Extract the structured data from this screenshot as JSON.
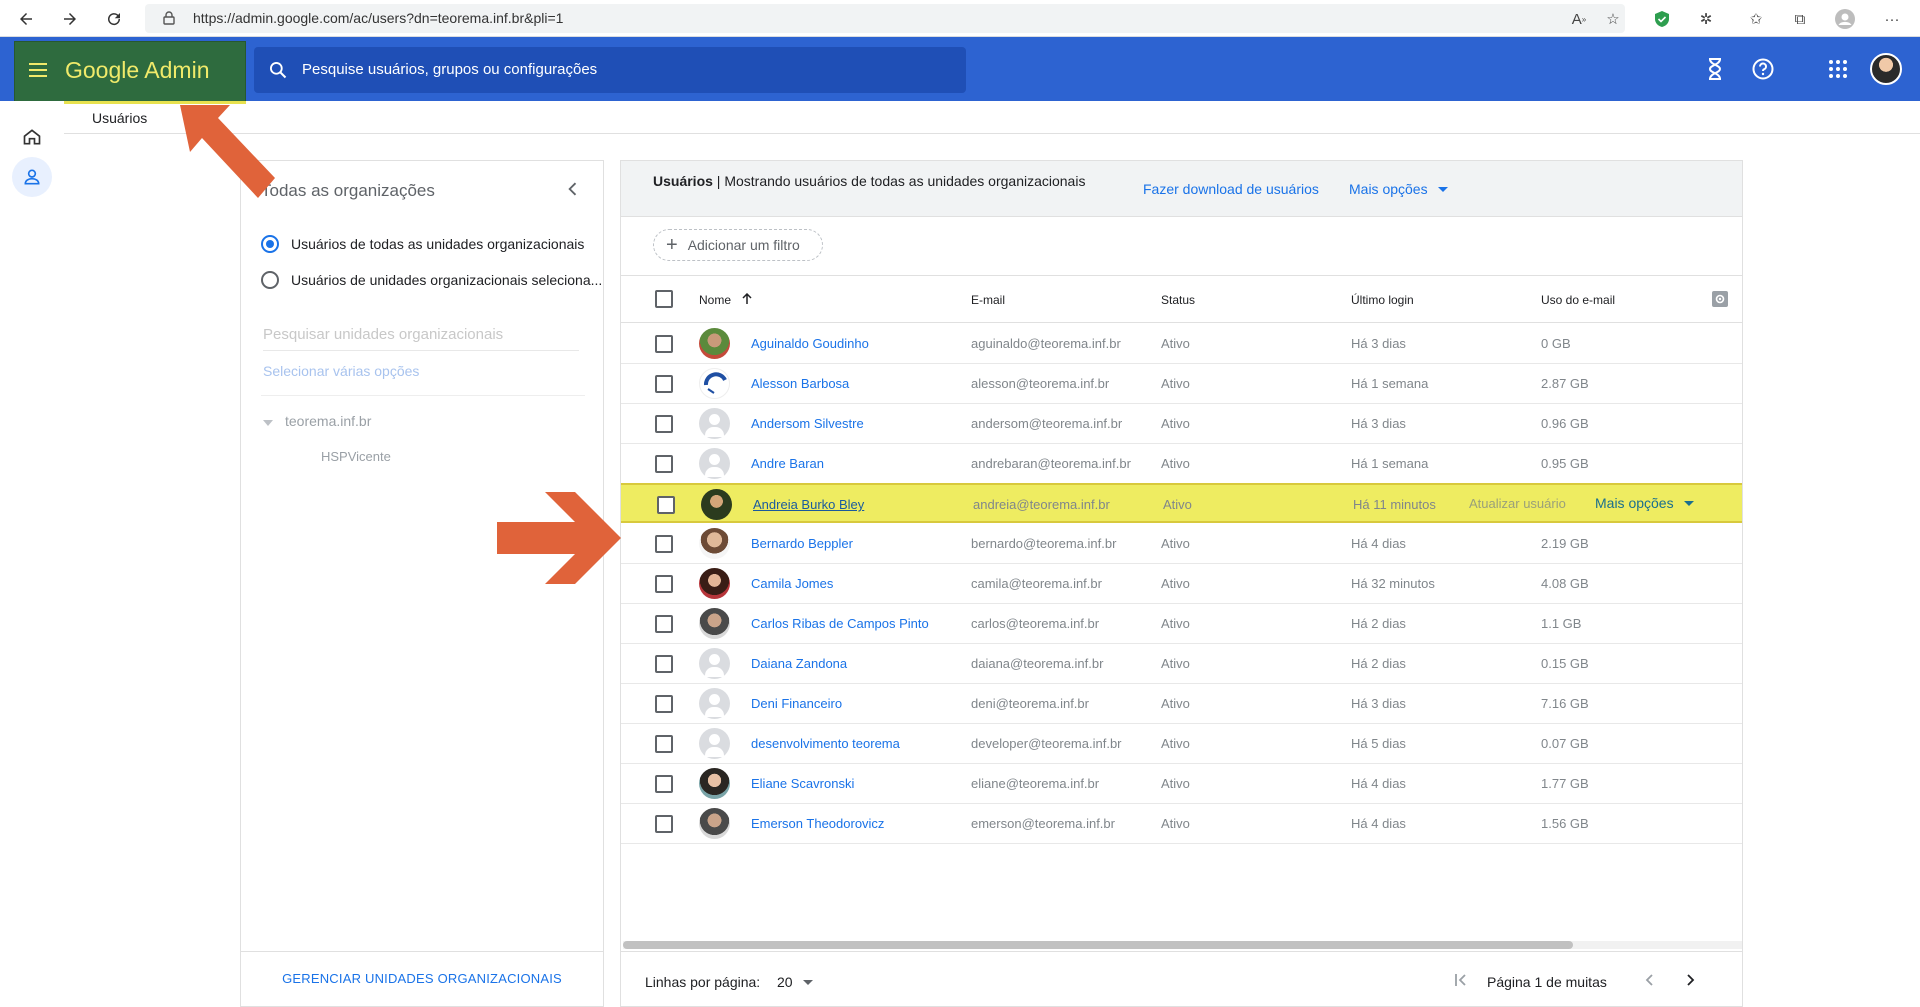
{
  "browser": {
    "url": "https://admin.google.com/ac/users?dn=teorema.inf.br&pli=1",
    "more_label": "···"
  },
  "header": {
    "brand": "Google Admin",
    "search_placeholder": "Pesquise usuários, grupos ou configurações"
  },
  "breadcrumb": "Usuários",
  "org_panel": {
    "title": "Todas as organizações",
    "radio_all": "Usuários de todas as unidades organizacionais",
    "radio_selected": "Usuários de unidades organizacionais seleciona...",
    "search_placeholder": "Pesquisar unidades organizacionais",
    "select_multi": "Selecionar várias opções",
    "tree_root": "teorema.inf.br",
    "tree_child": "HSPVicente",
    "manage": "GERENCIAR UNIDADES ORGANIZACIONAIS"
  },
  "users_panel": {
    "title_bold": "Usuários",
    "title_rest": " | Mostrando usuários de todas as unidades organizacionais",
    "download": "Fazer download de usuários",
    "more_options": "Mais opções",
    "add_filter": "Adicionar um filtro",
    "columns": {
      "name": "Nome",
      "email": "E-mail",
      "status": "Status",
      "last_login": "Último login",
      "email_usage": "Uso do e-mail"
    },
    "rows": [
      {
        "name": "Aguinaldo Goudinho",
        "email": "aguinaldo@teorema.inf.br",
        "status": "Ativo",
        "last_login": "Há 3 dias",
        "usage": "0 GB",
        "avatar": "photo-green"
      },
      {
        "name": "Alesson Barbosa",
        "email": "alesson@teorema.inf.br",
        "status": "Ativo",
        "last_login": "Há 1 semana",
        "usage": "2.87 GB",
        "avatar": "logo-blue"
      },
      {
        "name": "Andersom Silvestre",
        "email": "andersom@teorema.inf.br",
        "status": "Ativo",
        "last_login": "Há 3 dias",
        "usage": "0.96 GB",
        "avatar": "default"
      },
      {
        "name": "Andre Baran",
        "email": "andrebaran@teorema.inf.br",
        "status": "Ativo",
        "last_login": "Há 1 semana",
        "usage": "0.95 GB",
        "avatar": "default"
      },
      {
        "name": "Andreia Burko Bley",
        "email": "andreia@teorema.inf.br",
        "status": "Ativo",
        "last_login": "Há 11 minutos",
        "usage": "",
        "avatar": "photo-dark",
        "update_user": "Atualizar usuário",
        "more_options": "Mais opções",
        "highlighted": true
      },
      {
        "name": "Bernardo Beppler",
        "email": "bernardo@teorema.inf.br",
        "status": "Ativo",
        "last_login": "Há 4 dias",
        "usage": "2.19 GB",
        "avatar": "photo-warm"
      },
      {
        "name": "Camila Jomes",
        "email": "camila@teorema.inf.br",
        "status": "Ativo",
        "last_login": "Há 32 minutos",
        "usage": "4.08 GB",
        "avatar": "photo-red"
      },
      {
        "name": "Carlos Ribas de Campos Pinto",
        "email": "carlos@teorema.inf.br",
        "status": "Ativo",
        "last_login": "Há 2 dias",
        "usage": "1.1 GB",
        "avatar": "photo-grey"
      },
      {
        "name": "Daiana Zandona",
        "email": "daiana@teorema.inf.br",
        "status": "Ativo",
        "last_login": "Há 2 dias",
        "usage": "0.15 GB",
        "avatar": "default"
      },
      {
        "name": "Deni Financeiro",
        "email": "deni@teorema.inf.br",
        "status": "Ativo",
        "last_login": "Há 3 dias",
        "usage": "7.16 GB",
        "avatar": "default"
      },
      {
        "name": "desenvolvimento teorema",
        "email": "developer@teorema.inf.br",
        "status": "Ativo",
        "last_login": "Há 5 dias",
        "usage": "0.07 GB",
        "avatar": "default"
      },
      {
        "name": "Eliane Scavronski",
        "email": "eliane@teorema.inf.br",
        "status": "Ativo",
        "last_login": "Há 4 dias",
        "usage": "1.77 GB",
        "avatar": "photo-teal"
      },
      {
        "name": "Emerson Theodorovicz",
        "email": "emerson@teorema.inf.br",
        "status": "Ativo",
        "last_login": "Há 4 dias",
        "usage": "1.56 GB",
        "avatar": "photo-grey"
      }
    ],
    "rows_per_page_label": "Linhas por página:",
    "rows_per_page": "20",
    "page_info": "Página 1 de muitas"
  },
  "colors": {
    "header_blue": "#2d63d1",
    "brand_box": "#2e6b3e",
    "brand_text": "#f0ea6a",
    "highlight_row": "#eeec61",
    "annotation_arrow": "#e0633a",
    "link_blue": "#1a73e8"
  },
  "icons": {
    "back": "arrow-left-icon",
    "forward": "arrow-right-icon",
    "reload": "reload-icon",
    "menu": "hamburger-icon",
    "search": "search-icon",
    "hourglass": "hourglass-icon",
    "help": "help-icon",
    "apps": "apps-grid-icon",
    "home": "home-icon",
    "users": "person-icon"
  }
}
